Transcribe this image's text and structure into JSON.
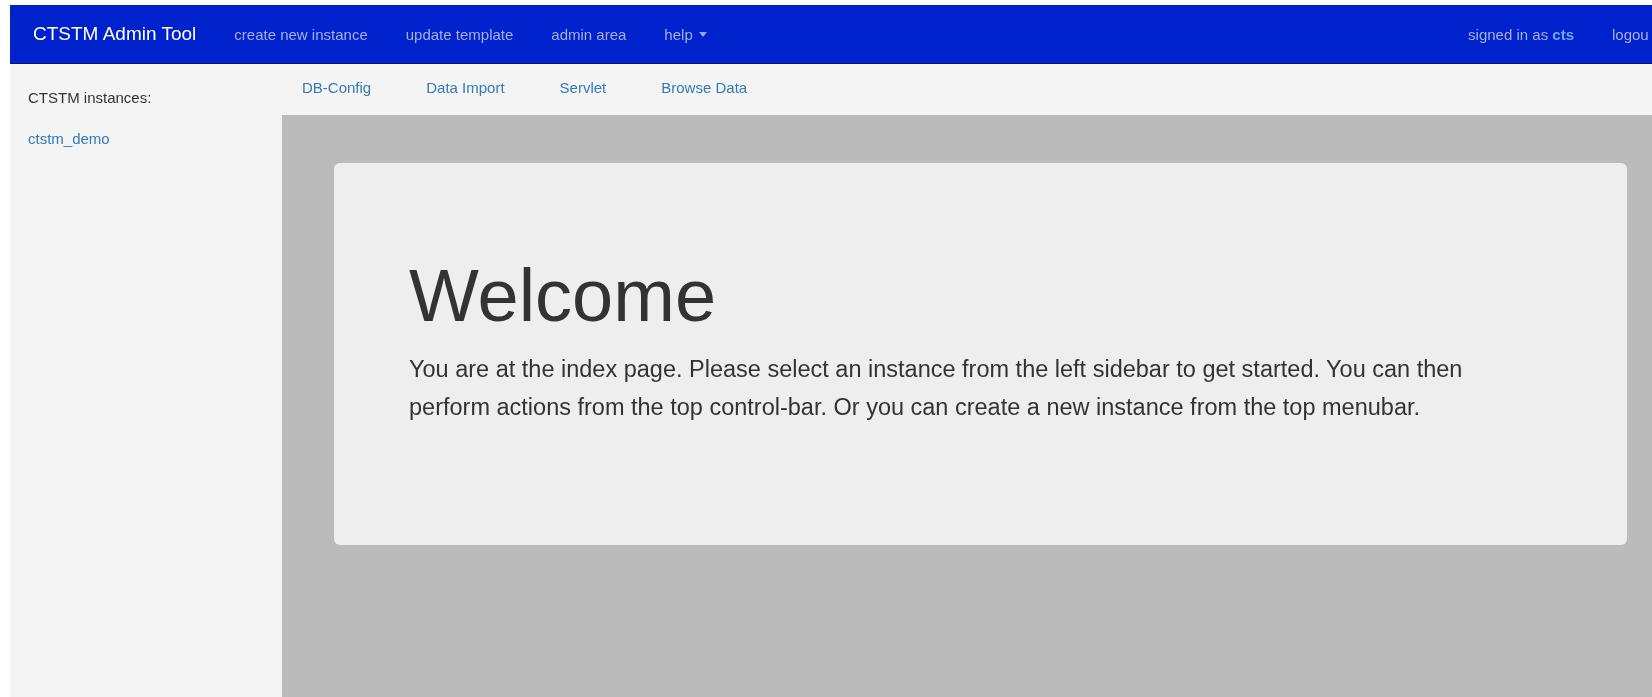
{
  "navbar": {
    "brand": "CTSTM Admin Tool",
    "links": [
      {
        "label": "create new instance"
      },
      {
        "label": "update template"
      },
      {
        "label": "admin area"
      },
      {
        "label": "help",
        "dropdown": true
      }
    ],
    "signed_in": "signed in as **cts**",
    "logout": "logou"
  },
  "sidebar": {
    "heading": "CTSTM instances:",
    "items": [
      {
        "label": "ctstm_demo"
      }
    ]
  },
  "subnav": [
    {
      "label": "DB-Config"
    },
    {
      "label": "Data Import"
    },
    {
      "label": "Servlet"
    },
    {
      "label": "Browse Data"
    }
  ],
  "jumbotron": {
    "title": "Welcome",
    "text": "You are at the index page. Please select an instance from the left sidebar to get started. You can then perform actions from the top control-bar. Or you can create a new instance from the top menubar."
  }
}
